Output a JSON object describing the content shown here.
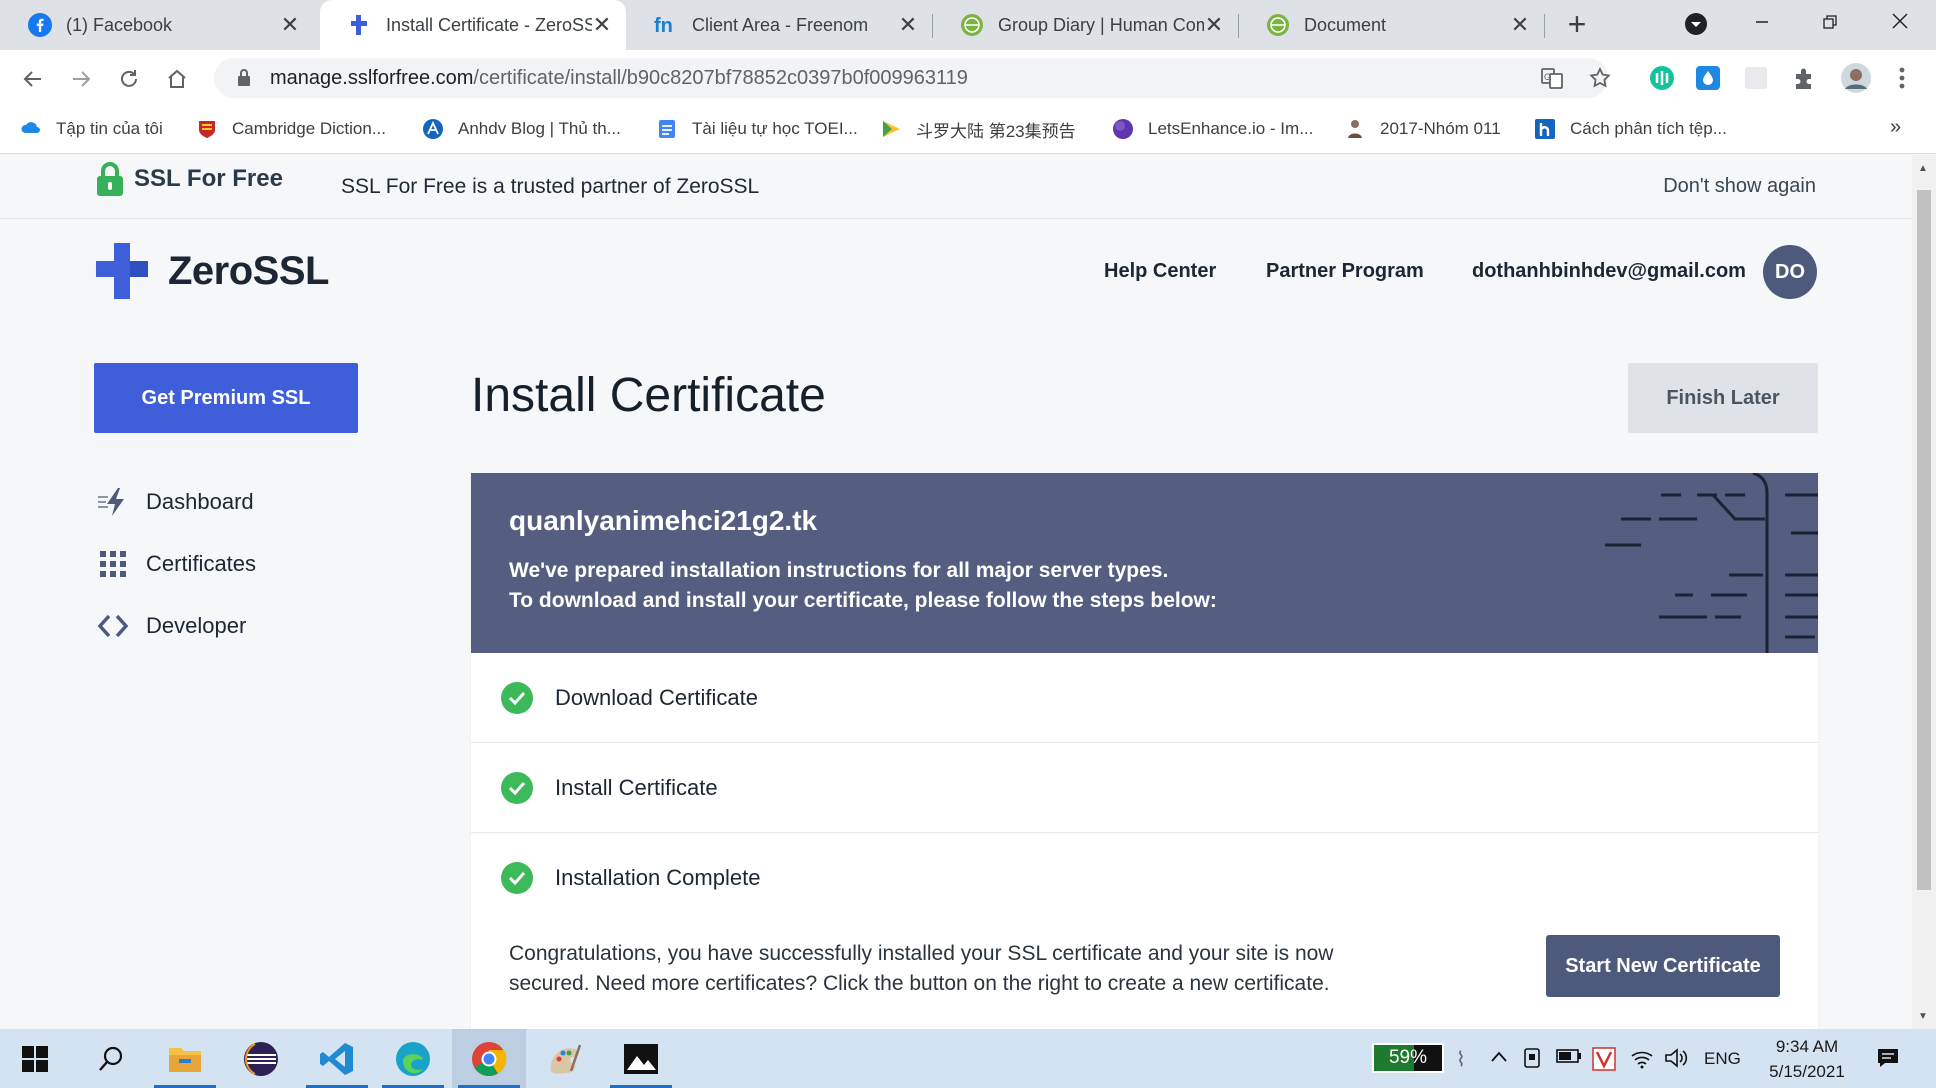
{
  "browser": {
    "tabs": [
      {
        "title": "(1) Facebook",
        "icon": "facebook-icon",
        "active": false
      },
      {
        "title": "Install Certificate - ZeroSSL",
        "icon": "zerossl-icon",
        "active": true
      },
      {
        "title": "Client Area - Freenom",
        "icon": "freenom-icon",
        "active": false
      },
      {
        "title": "Group Diary | Human Com",
        "icon": "globe-icon",
        "active": false
      },
      {
        "title": "Document",
        "icon": "globe-icon",
        "active": false
      }
    ],
    "close_glyph": "✕",
    "new_tab_glyph": "+",
    "address": {
      "host": "manage.sslforfree.com",
      "path": "/certificate/install/b90c8207bf78852c0397b0f009963119"
    },
    "bookmarks": [
      {
        "label": "Tập tin của tôi",
        "icon": "cloud-drive-icon"
      },
      {
        "label": "Cambridge Diction...",
        "icon": "cambridge-icon"
      },
      {
        "label": "Anhdv Blog | Thủ th...",
        "icon": "anhdv-icon"
      },
      {
        "label": "Tài liệu tự học TOEI...",
        "icon": "doc-icon"
      },
      {
        "label": "斗罗大陆 第23集预告",
        "icon": "play-icon"
      },
      {
        "label": "LetsEnhance.io - Im...",
        "icon": "letsenhance-icon"
      },
      {
        "label": "2017-Nhóm 011",
        "icon": "group-icon"
      },
      {
        "label": "Cách phân tích tệp...",
        "icon": "h-icon"
      }
    ],
    "bookmarks_overflow": "»"
  },
  "notice_bar": {
    "brand": "SSL For Free",
    "message": "SSL For Free is a trusted partner of ZeroSSL",
    "dismiss": "Don't show again"
  },
  "header": {
    "logo_text": "ZeroSSL",
    "nav": [
      "Help Center",
      "Partner Program"
    ],
    "user_email": "dothanhbinhdev@gmail.com",
    "avatar_initials": "DO"
  },
  "sidebar": {
    "cta": "Get Premium SSL",
    "items": [
      {
        "label": "Dashboard",
        "icon": "lightning-icon"
      },
      {
        "label": "Certificates",
        "icon": "grid-icon"
      },
      {
        "label": "Developer",
        "icon": "code-icon"
      }
    ]
  },
  "main": {
    "title": "Install Certificate",
    "finish_later": "Finish Later",
    "card": {
      "domain": "quanlyanimehci21g2.tk",
      "intro_line1": "We've prepared installation instructions for all major server types.",
      "intro_line2": "To download and install your certificate, please follow the steps below:",
      "steps": [
        {
          "label": "Download Certificate",
          "status": "complete"
        },
        {
          "label": "Install Certificate",
          "status": "complete"
        },
        {
          "label": "Installation Complete",
          "status": "complete"
        }
      ],
      "congrats_line1": "Congratulations, you have successfully installed your SSL certificate and your site is now",
      "congrats_line2": "secured. Need more certificates? Click the button on the right to create a new certificate.",
      "start_new": "Start New Certificate"
    }
  },
  "taskbar": {
    "battery_percent": "59%",
    "battery_level": 0.59,
    "language": "ENG",
    "time": "9:34 AM",
    "date": "5/15/2021"
  },
  "colors": {
    "primary": "#3e5fd9",
    "card_header": "#555e80",
    "success": "#3cb959",
    "avatar": "#4d5a7c"
  }
}
